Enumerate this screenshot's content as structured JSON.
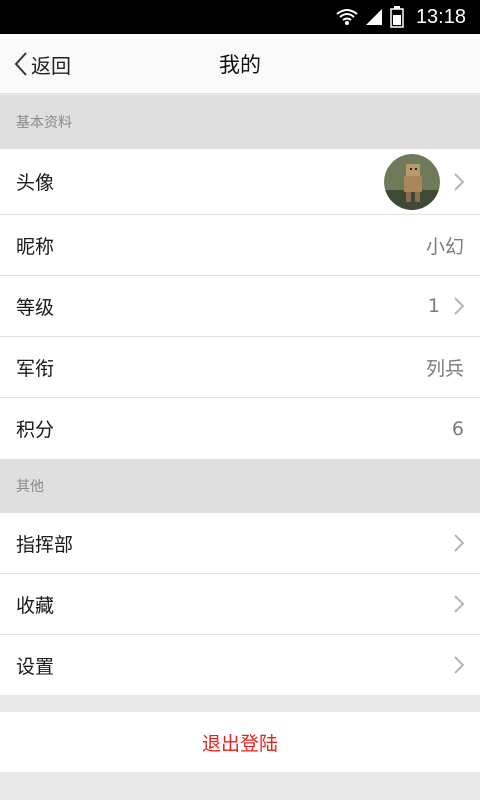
{
  "status_bar": {
    "time": "13:18"
  },
  "nav": {
    "back_label": "返回",
    "title": "我的"
  },
  "sections": {
    "basic": {
      "header": "基本资料",
      "rows": [
        {
          "label": "头像",
          "value": ""
        },
        {
          "label": "昵称",
          "value": "小幻"
        },
        {
          "label": "等级",
          "value": "1"
        },
        {
          "label": "军衔",
          "value": "列兵"
        },
        {
          "label": "积分",
          "value": "6"
        }
      ]
    },
    "other": {
      "header": "其他",
      "rows": [
        {
          "label": "指挥部"
        },
        {
          "label": "收藏"
        },
        {
          "label": "设置"
        }
      ]
    }
  },
  "logout_label": "退出登陆",
  "colors": {
    "accent": "#e8231b",
    "section_bg": "#dfdfdf",
    "row_bg": "#ffffff"
  },
  "icons": [
    "wifi-icon",
    "signal-icon",
    "battery-icon",
    "back-chevron-icon",
    "chevron-right-icon"
  ]
}
